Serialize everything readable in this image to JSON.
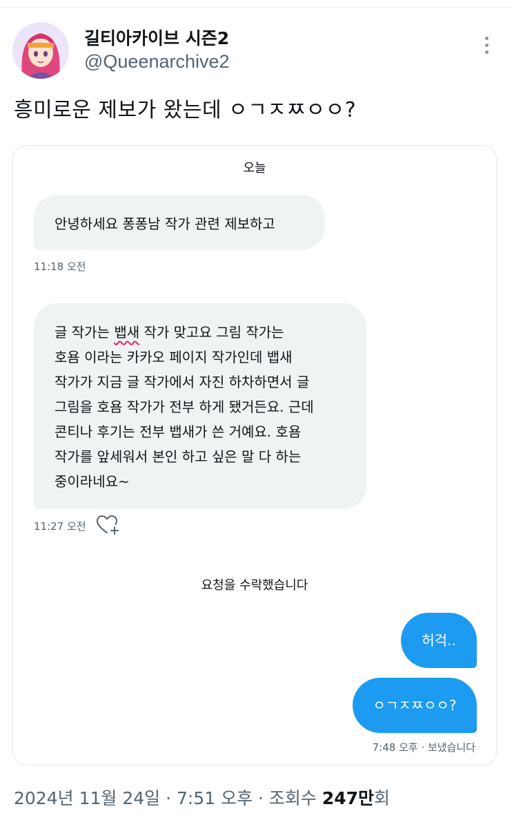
{
  "tweet": {
    "display_name": "길티아카이브 시즌2",
    "handle": "@Queenarchive2",
    "text": "흥미로운 제보가 왔는데 ㅇㄱㅈㅉㅇㅇ?",
    "date_time": "2024년 11월 24일 · 7:51 오후 · 조회수 ",
    "views_number": "247만",
    "views_suffix": "회"
  },
  "dm": {
    "date_label": "오늘",
    "messages": [
      {
        "text": "안녕하세요 퐁퐁남 작가 관련 제보하고",
        "time": "11:18 오전"
      },
      {
        "lines": [
          "글 작가는 ",
          "뱁새",
          " 작가 맞고요 그림 작가는",
          "호욤 이라는 카카오 페이지 작가인데 뱁새",
          "작가가 지금 글 작가에서 자진 하차하면서 글",
          "그림을 호욤 작가가 전부 하게 됐거든요. 근데",
          "콘티나 후기는 전부 뱁새가 쓴 거예요. 호욤",
          "작가를 앞세워서 본인 하고 싶은 말 다 하는",
          "중이라네요~"
        ],
        "time": "11:27 오전"
      }
    ],
    "system_message": "요청을 수락했습니다",
    "sent": [
      {
        "text": "허걱.."
      },
      {
        "text": "ㅇㄱㅈㅉㅇㅇ?"
      }
    ],
    "sent_meta": "7:48 오후 · 보냈습니다"
  },
  "colors": {
    "accent": "#1d9bf0",
    "bubble_received": "#eff3f4",
    "secondary_text": "#536471"
  },
  "icons": [
    "avatar",
    "more-icon",
    "heart-add-icon"
  ]
}
